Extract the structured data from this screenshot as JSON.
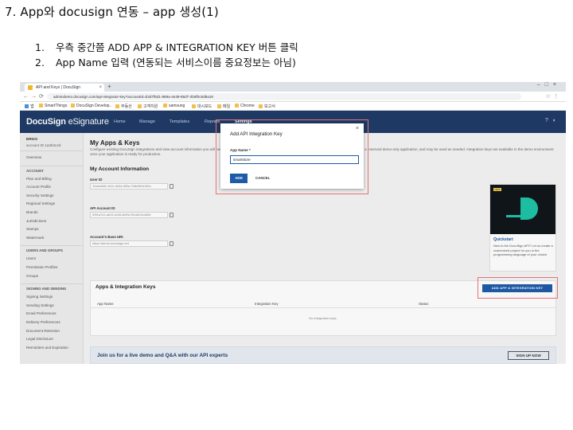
{
  "slide": {
    "title": "7. App와 docusign 연동 – app 생성(1)",
    "steps": [
      {
        "num": "1.",
        "text": "우측 중간쯤 ADD APP & INTEGRATION KEY 버튼 클릭"
      },
      {
        "num": "2.",
        "text": "App Name 입력 (연동되는 서비스이름 중요정보는 아님)"
      }
    ]
  },
  "browser": {
    "tab_title": "API and Keys | DocuSign",
    "url": "admindemo.docusign.com/api-integrator-key?accountId=b3d7f6d1-889a-4e39-88d7-2b6f0c6d9a19",
    "bookmarks": [
      "앱",
      "SmartThings",
      "DocuSign Develop..",
      "부동산",
      "고객지원",
      "samsung",
      "대시보드",
      "메일",
      "Chrome",
      "보고서"
    ]
  },
  "app": {
    "logo_bold": "DocuSign",
    "logo_rest": " eSignature",
    "nav": [
      "Home",
      "Manage",
      "Templates",
      "Reports",
      "Settings"
    ]
  },
  "sidebar": {
    "user_name": "ERGO",
    "user_email": "account ID 1a2b3c4d",
    "items": [
      {
        "kind": "item",
        "label": "Overview"
      },
      {
        "kind": "head",
        "label": "ACCOUNT"
      },
      {
        "kind": "item",
        "label": "Plan and Billing"
      },
      {
        "kind": "item",
        "label": "Account Profile"
      },
      {
        "kind": "item",
        "label": "Security Settings"
      },
      {
        "kind": "item",
        "label": "Regional Settings"
      },
      {
        "kind": "item",
        "label": "Brands"
      },
      {
        "kind": "item",
        "label": "Jurisdictions"
      },
      {
        "kind": "item",
        "label": "Stamps"
      },
      {
        "kind": "item",
        "label": "Watermark"
      },
      {
        "kind": "head",
        "label": "USERS AND GROUPS"
      },
      {
        "kind": "item",
        "label": "Users"
      },
      {
        "kind": "item",
        "label": "Permission Profiles"
      },
      {
        "kind": "item",
        "label": "Groups"
      },
      {
        "kind": "head",
        "label": "SIGNING AND SENDING"
      },
      {
        "kind": "item",
        "label": "Signing Settings"
      },
      {
        "kind": "item",
        "label": "Sending Settings"
      },
      {
        "kind": "item",
        "label": "Email Preferences"
      },
      {
        "kind": "item",
        "label": "Delivery Preferences"
      },
      {
        "kind": "item",
        "label": "Document Retention"
      },
      {
        "kind": "item",
        "label": "Legal Disclosure"
      },
      {
        "kind": "item",
        "label": "Reminders and Expiration"
      }
    ]
  },
  "main": {
    "title": "My Apps & Keys",
    "description": "Configure existing DocuSign integrations and view account information you will need for the integration. Connect your apps, services and configure Connect. Integrations are a reserved demo-only application, and may be used as needed. Integration keys are available in the demo environment once your application is ready for production.",
    "account_info_title": "My Account Information",
    "fields": [
      {
        "label": "User ID",
        "value": "12a4c5d6-1b2c-3d4e-5f6a-7b8c9d0e1f2a"
      },
      {
        "label": "API Account ID",
        "value": "09f1a7c2-ab34-4c56-8d9e-0f1a2b3c4d5e"
      },
      {
        "label": "Account's Base URI",
        "value": "https://demo.docusign.net"
      }
    ],
    "promo": {
      "tag": "NEW",
      "title": "Quickstart",
      "text": "New to the DocuSign API? Let us create a customized project for you in the programming language of your choice."
    },
    "keys": {
      "title": "Apps & Integration Keys",
      "add_button": "ADD APP & INTEGRATION KEY",
      "columns": [
        "App Name",
        "Integration Key",
        "Status"
      ],
      "empty_text": "No integration keys."
    },
    "banner": {
      "text": "Join us for a live demo and Q&A with our API experts",
      "button": "SIGN UP NOW"
    }
  },
  "modal": {
    "title": "Add API Integration Key",
    "label": "App Name *",
    "input_value": "smartstore",
    "add_label": "ADD",
    "cancel_label": "CANCEL"
  },
  "colors": {
    "header": "#1e3a66",
    "accent": "#1e5aa8",
    "highlight": "#e57373"
  }
}
